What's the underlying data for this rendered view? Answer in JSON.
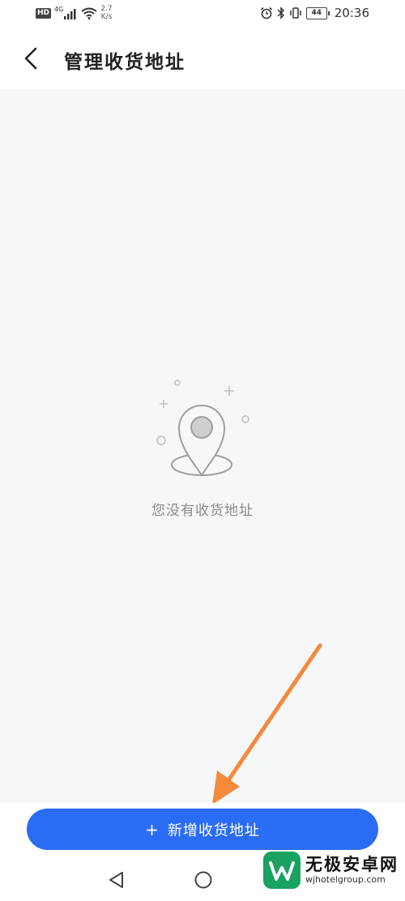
{
  "status_bar": {
    "hd_badge": "HD",
    "network_type": "4G",
    "speed_value": "2.7",
    "speed_unit": "K/s",
    "battery_level": "44",
    "time": "20:36"
  },
  "header": {
    "title": "管理收货地址"
  },
  "empty_state": {
    "message": "您没有收货地址"
  },
  "actions": {
    "add_address_plus": "+",
    "add_address_label": "新增收货地址"
  },
  "watermark": {
    "title": "无极安卓网",
    "url": "wjhotelgroup.com"
  },
  "colors": {
    "primary": "#2b6cf5",
    "background": "#f6f7f9",
    "annotation_arrow": "#f58a3a"
  }
}
